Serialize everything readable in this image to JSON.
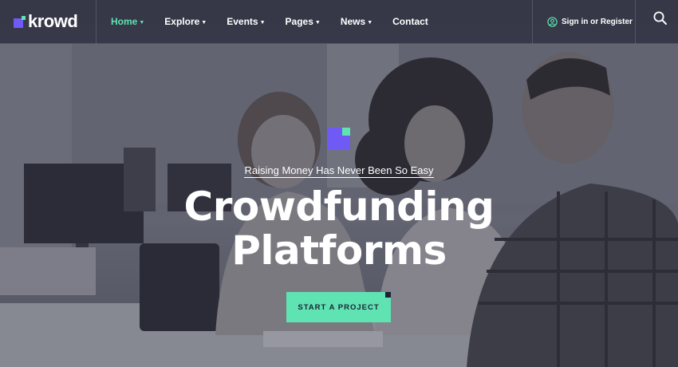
{
  "brand": {
    "name": "krowd"
  },
  "nav": {
    "items": [
      {
        "label": "Home",
        "active": true,
        "has_dropdown": true
      },
      {
        "label": "Explore",
        "active": false,
        "has_dropdown": true
      },
      {
        "label": "Events",
        "active": false,
        "has_dropdown": true
      },
      {
        "label": "Pages",
        "active": false,
        "has_dropdown": true
      },
      {
        "label": "News",
        "active": false,
        "has_dropdown": true
      },
      {
        "label": "Contact",
        "active": false,
        "has_dropdown": false
      }
    ],
    "signin_label": "Sign in or Register",
    "signin_icon": "user-circle-icon",
    "search_icon": "search-icon"
  },
  "hero": {
    "tagline": "Raising Money Has Never Been So Easy",
    "title_line1": "Crowdfunding",
    "title_line2": "Platforms",
    "cta_label": "START A PROJECT"
  },
  "colors": {
    "accent_green": "#5fe3b3",
    "accent_purple": "#6f5af5",
    "header_bg": "#2c2e3e",
    "text_dark": "#1f2235"
  }
}
